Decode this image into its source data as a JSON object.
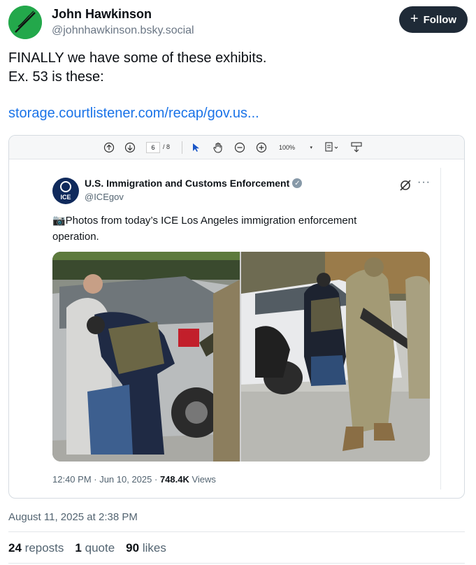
{
  "author": {
    "name": "John Hawkinson",
    "handle": "@johnhawkinson.bsky.social",
    "follow_label": "Follow"
  },
  "post": {
    "text_line1": "FINALLY we have some of these exhibits.",
    "text_line2": "Ex. 53 is these:",
    "link": "storage.courtlistener.com/recap/gov.us...",
    "date": "August 11, 2025 at 2:38 PM"
  },
  "pdf_viewer": {
    "page_current": "6",
    "page_total": "/ 8",
    "zoom": "100%"
  },
  "embedded_tweet": {
    "name": "U.S. Immigration and Customs Enforcement",
    "handle": "@ICEgov",
    "logo_text": "ICE",
    "text_line1": "📷Photos from today’s ICE Los Angeles immigration enforcement",
    "text_line2": "operation.",
    "time": "12:40 PM · Jun 10, 2025 · ",
    "views_count": "748.4K",
    "views_label": " Views"
  },
  "stats": {
    "reposts_count": "24",
    "reposts_label": "reposts",
    "quotes_count": "1",
    "quotes_label": "quote",
    "likes_count": "90",
    "likes_label": "likes"
  },
  "colors": {
    "accent_link": "#1a73e8",
    "follow_bg": "#1f2a37",
    "avatar_bg": "#22a84a"
  }
}
